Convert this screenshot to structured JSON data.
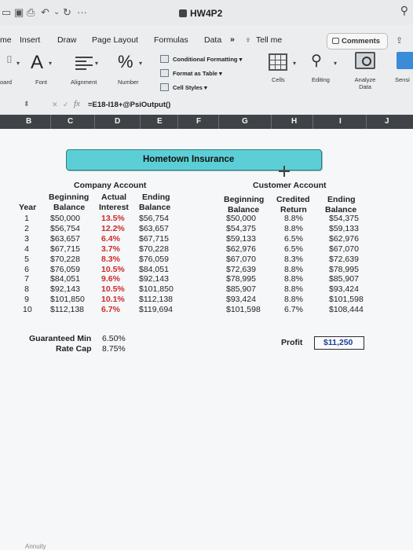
{
  "window": {
    "title": "HW4P2"
  },
  "menu": {
    "tabs": [
      "me",
      "Insert",
      "Draw",
      "Page Layout",
      "Formulas",
      "Data",
      "»",
      "Tell me"
    ],
    "comments_label": "Comments"
  },
  "ribbon": {
    "clipboard_label": "oard",
    "font_label": "Font",
    "alignment_label": "Alignment",
    "number_label": "Number",
    "conditional_formatting": "Conditional Formatting",
    "format_as_table": "Format as Table",
    "cell_styles": "Cell Styles",
    "cells_label": "Cells",
    "editing_label": "Editing",
    "analyze_label": "Analyze Data",
    "sensitivity_label": "Sensi"
  },
  "formula_bar": {
    "fx": "fx",
    "formula": "=E18-I18+@PsiOutput()"
  },
  "columns": [
    "B",
    "C",
    "D",
    "E",
    "F",
    "G",
    "H",
    "I",
    "J"
  ],
  "sheet": {
    "banner": "Hometown Insurance",
    "company_header": "Company Account",
    "customer_header": "Customer Account",
    "headers": {
      "year": "Year",
      "beginning": "Beginning",
      "balance": "Balance",
      "actual": "Actual",
      "interest": "Interest",
      "ending": "Ending",
      "credited": "Credited",
      "return": "Return"
    },
    "rows": [
      {
        "year": "1",
        "beg": "$50,000",
        "rate": "13.5%",
        "end": "$56,754",
        "cbeg": "$50,000",
        "cred": "8.8%",
        "cend": "$54,375"
      },
      {
        "year": "2",
        "beg": "$56,754",
        "rate": "12.2%",
        "end": "$63,657",
        "cbeg": "$54,375",
        "cred": "8.8%",
        "cend": "$59,133"
      },
      {
        "year": "3",
        "beg": "$63,657",
        "rate": "6.4%",
        "end": "$67,715",
        "cbeg": "$59,133",
        "cred": "6.5%",
        "cend": "$62,976"
      },
      {
        "year": "4",
        "beg": "$67,715",
        "rate": "3.7%",
        "end": "$70,228",
        "cbeg": "$62,976",
        "cred": "6.5%",
        "cend": "$67,070"
      },
      {
        "year": "5",
        "beg": "$70,228",
        "rate": "8.3%",
        "end": "$76,059",
        "cbeg": "$67,070",
        "cred": "8.3%",
        "cend": "$72,639"
      },
      {
        "year": "6",
        "beg": "$76,059",
        "rate": "10.5%",
        "end": "$84,051",
        "cbeg": "$72,639",
        "cred": "8.8%",
        "cend": "$78,995"
      },
      {
        "year": "7",
        "beg": "$84,051",
        "rate": "9.6%",
        "end": "$92,143",
        "cbeg": "$78,995",
        "cred": "8.8%",
        "cend": "$85,907"
      },
      {
        "year": "8",
        "beg": "$92,143",
        "rate": "10.5%",
        "end": "$101,850",
        "cbeg": "$85,907",
        "cred": "8.8%",
        "cend": "$93,424"
      },
      {
        "year": "9",
        "beg": "$101,850",
        "rate": "10.1%",
        "end": "$112,138",
        "cbeg": "$93,424",
        "cred": "8.8%",
        "cend": "$101,598"
      },
      {
        "year": "10",
        "beg": "$112,138",
        "rate": "6.7%",
        "end": "$119,694",
        "cbeg": "$101,598",
        "cred": "6.7%",
        "cend": "$108,444"
      }
    ],
    "guaranteed_min_label": "Guaranteed Min",
    "guaranteed_min_value": "6.50%",
    "rate_cap_label": "Rate Cap",
    "rate_cap_value": "8.75%",
    "profit_label": "Profit",
    "profit_value": "$11,250",
    "sheet_tab": "Annuity"
  },
  "colors": {
    "banner": "#5ccfd6",
    "rate_red": "#cc2b2b",
    "profit_blue": "#1b3d9a",
    "col_header": "#3f4246"
  }
}
